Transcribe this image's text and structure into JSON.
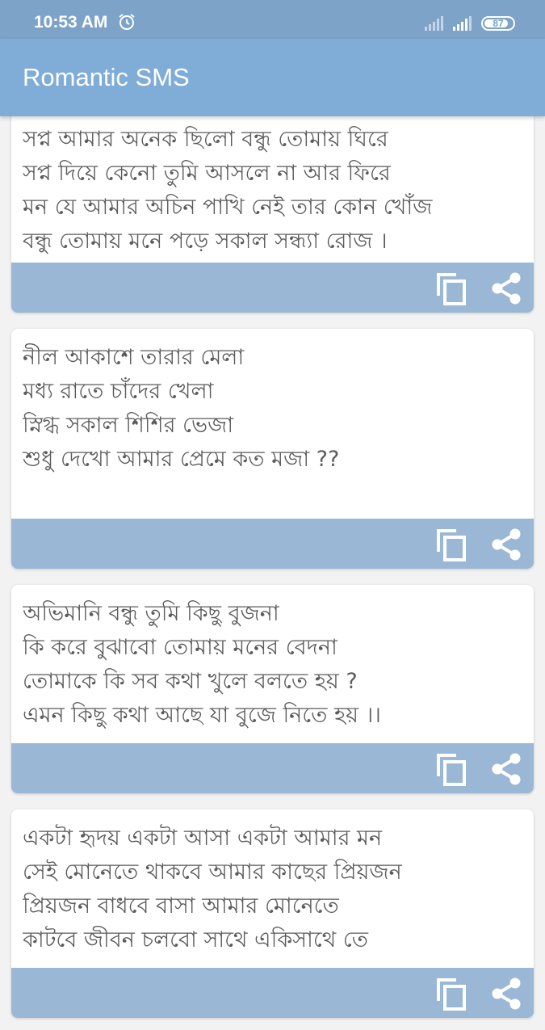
{
  "status_bar": {
    "time": "10:53 AM",
    "battery": "87"
  },
  "app_bar": {
    "title": "Romantic SMS"
  },
  "cards": [
    {
      "lines": [
        "সপ্ন আমার অনেক ছিলো বন্ধু তোমায় ঘিরে",
        "সপ্ন দিয়ে কেনো তুমি আসলে না আর ফিরে",
        "মন যে আমার অচিন পাখি নেই তার কোন খোঁজ",
        "বন্ধু তোমায় মনে পড়ে সকাল সন্ধ্যা রোজ ।"
      ]
    },
    {
      "lines": [
        "নীল আকাশে তারার মেলা",
        "মধ্য রাতে চাঁদের খেলা",
        "স্নিগ্ধ সকাল শিশির ভেজা",
        "শুধু দেখো আমার প্রেমে কত মজা ??"
      ]
    },
    {
      "lines": [
        "অভিমানি বন্ধু তুমি কিছু বুজনা",
        "কি করে বুঝাবো তোমায় মনের বেদনা",
        "তোমাকে কি সব কথা খুলে বলতে হয় ?",
        "এমন কিছু কথা আছে যা বুজে নিতে হয় ।।"
      ]
    },
    {
      "lines": [
        "একটা হৃদয় একটা আসা একটা আমার মন",
        "সেই মোনেতে থাকবে আমার কাছের প্রিয়জন",
        "প্রিয়জন বাধবে বাসা আমার মোনেতে",
        "কাটবে জীবন চলবো সাথে একিসাথে তে"
      ]
    }
  ],
  "icons": {
    "copy": "copy-icon",
    "share": "share-icon"
  }
}
